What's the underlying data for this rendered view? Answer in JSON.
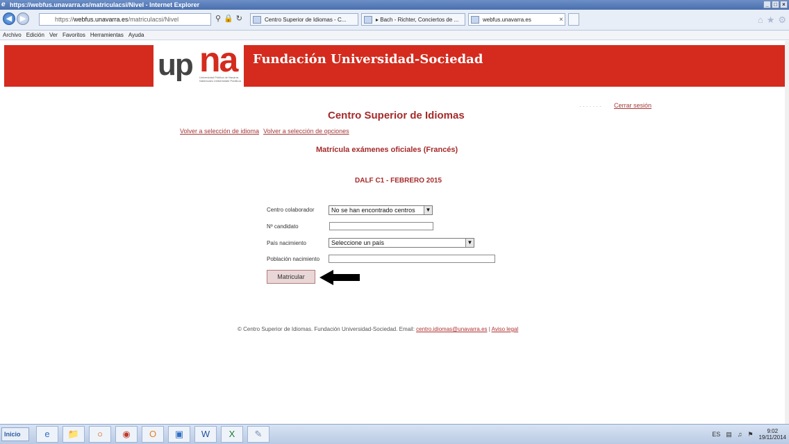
{
  "window": {
    "title": "https://webfus.unavarra.es/matriculacsi/Nivel - Internet Explorer",
    "controls": [
      "_",
      "□",
      "×"
    ]
  },
  "addressbar": {
    "url_prefix": "https://",
    "url_domain": "webfus.unavarra.es",
    "url_path": "/matriculacsi/Nivel",
    "tabs": [
      "Centro Superior de Idiomas - C...",
      "▸ Bach - Richter, Conciertos de ...",
      "webfus.unavarra.es"
    ],
    "tab_close": "×"
  },
  "menubar": [
    "Archivo",
    "Edición",
    "Ver",
    "Favoritos",
    "Herramientas",
    "Ayuda"
  ],
  "header": {
    "logo_up": "up",
    "logo_na": "na",
    "logo_subtext": "Universidad Pública de Navarra Nafarroako Unibertsitate Publikoa",
    "title": "Fundación Universidad-Sociedad",
    "brand_color": "#d42b1e"
  },
  "content": {
    "logout_pre": "· · · · · · ·",
    "logout": "Cerrar sesión",
    "center_title": "Centro Superior de Idiomas",
    "link_language": "Volver a selección de idioma",
    "link_options": "Volver a selección de opciones",
    "subtitle": "Matrícula exámenes oficiales (Francés)",
    "exam": "DALF C1 - FEBRERO 2015"
  },
  "form": {
    "centro_label": "Centro colaborador",
    "centro_value": "No se han encontrado centros",
    "candidato_label": "Nº candidato",
    "candidato_value": "",
    "pais_label": "País nacimiento",
    "pais_value": "Seleccione un país",
    "poblacion_label": "Población nacimiento",
    "poblacion_value": "",
    "submit": "Matricular"
  },
  "footer": {
    "text": "© Centro Superior de Idiomas. Fundación Universidad-Sociedad. Email: ",
    "email": "centro.idiomas@unavarra.es",
    "separator": " | ",
    "legal": "Aviso legal"
  },
  "taskbar": {
    "start": "Inicio",
    "language": "ES",
    "time": "9:02",
    "date": "19/11/2014"
  }
}
